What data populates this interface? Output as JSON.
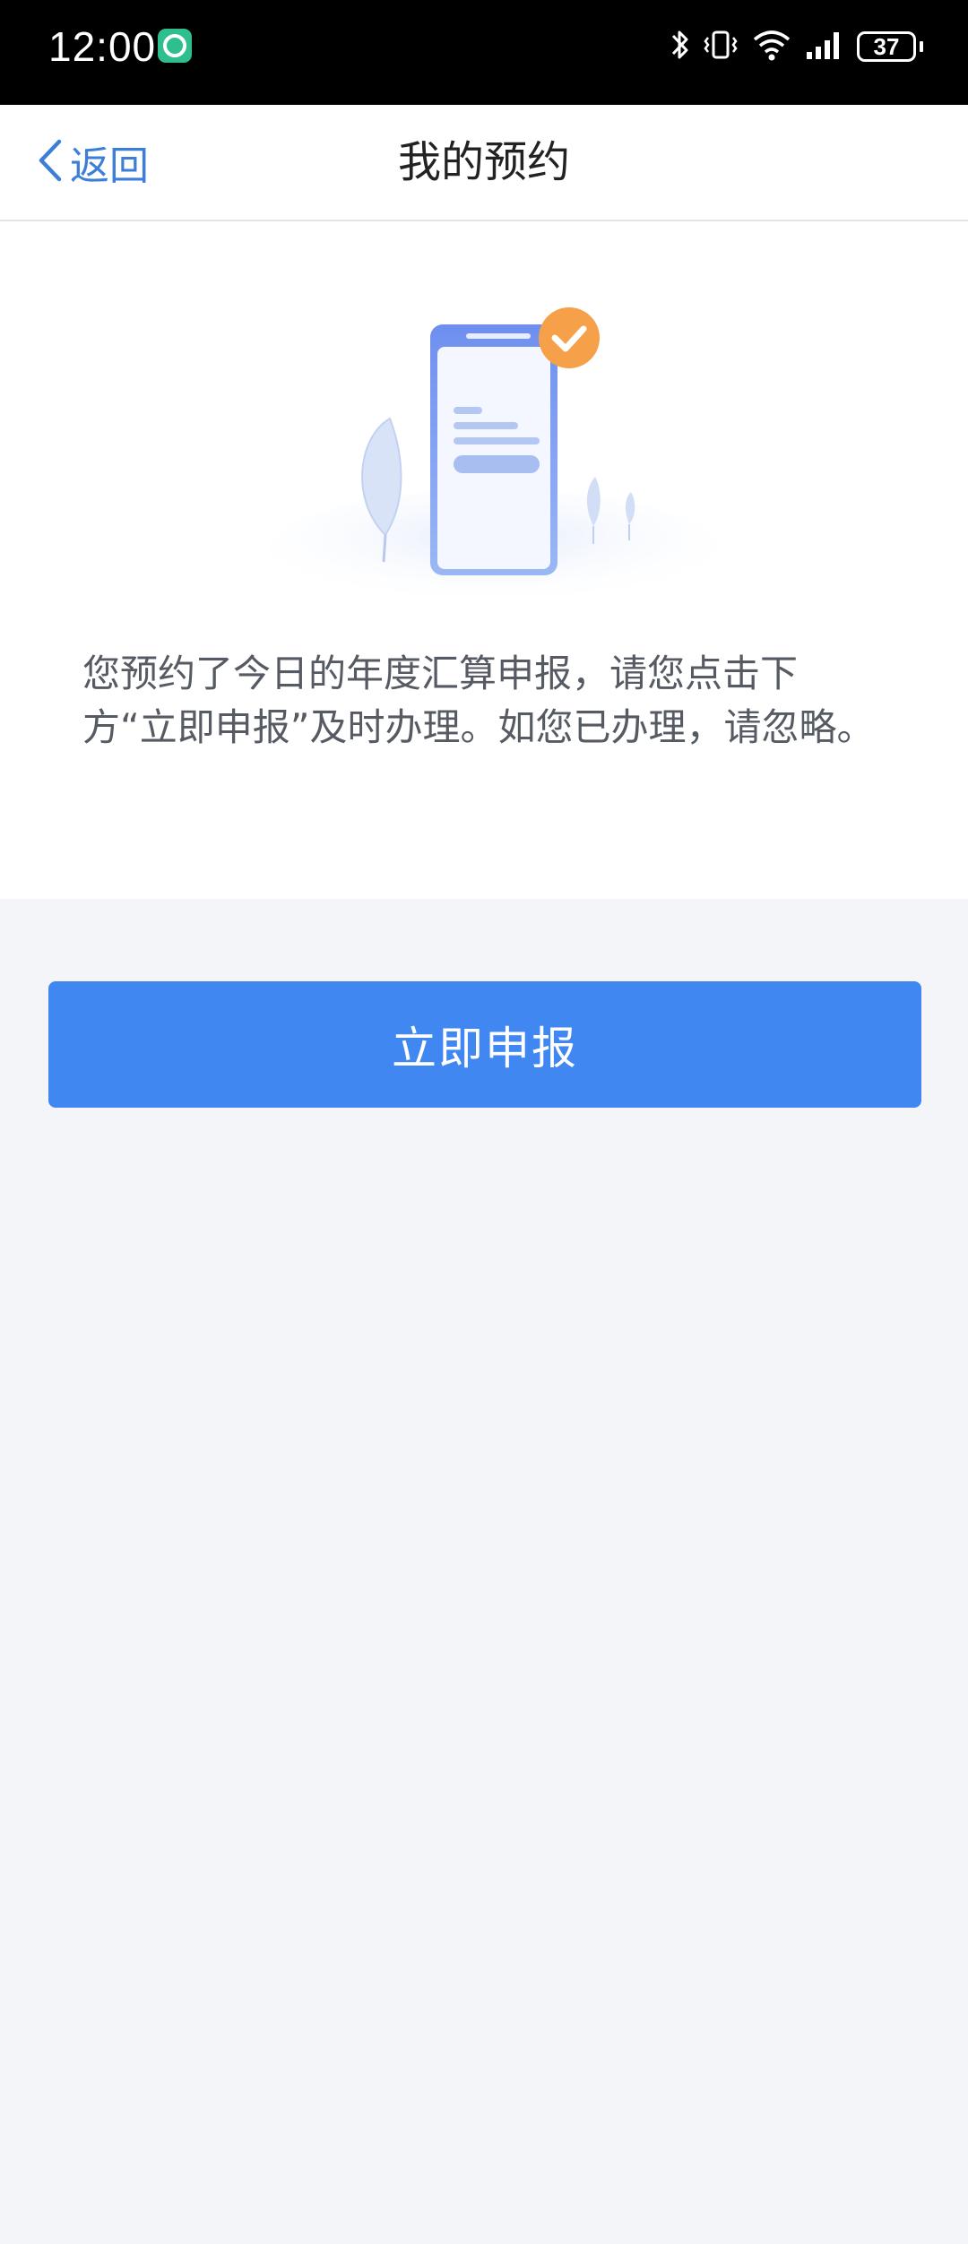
{
  "status_bar": {
    "time": "12:00",
    "battery_level": "37"
  },
  "nav": {
    "back_label": "返回",
    "title": "我的预约"
  },
  "notice": {
    "message": "您预约了今日的年度汇算申报，请您点击下方“立即申报”及时办理。如您已办理，请忽略。"
  },
  "actions": {
    "declare_now_label": "立即申报"
  },
  "colors": {
    "accent": "#4187f1",
    "back_link": "#3d7fd8",
    "page_background": "#f3f5f9",
    "check_badge": "#f7a04a"
  },
  "icons": {
    "status_app": "app-notification-icon",
    "bluetooth": "bluetooth-icon",
    "vibrate": "vibrate-icon",
    "wifi": "wifi-icon",
    "signal": "cell-signal-icon",
    "back": "chevron-left-icon",
    "illustration": "phone-check-illustration"
  }
}
